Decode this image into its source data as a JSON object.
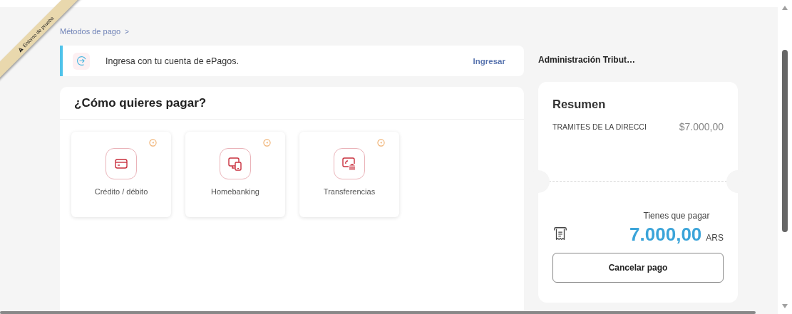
{
  "ribbon": {
    "label": "Entorno de prueba"
  },
  "breadcrumb": {
    "label": "Métodos de pago",
    "separator": ">"
  },
  "login_banner": {
    "text": "Ingresa con tu cuenta de ePagos.",
    "action": "Ingresar"
  },
  "merchant": "Administración Tribut…",
  "payment": {
    "title": "¿Cómo quieres pagar?",
    "methods": [
      {
        "kind": "card",
        "label": "Crédito / débito"
      },
      {
        "kind": "homebanking",
        "label": "Homebanking"
      },
      {
        "kind": "transfer",
        "label": "Transferencias"
      }
    ]
  },
  "summary": {
    "title": "Resumen",
    "items": [
      {
        "concept": "TRAMITES DE LA DIRECCI",
        "amount": "$7.000,00"
      }
    ],
    "total_label": "Tienes que pagar",
    "total": "7.000,00",
    "currency": "ARS",
    "cancel_button": "Cancelar pago"
  }
}
